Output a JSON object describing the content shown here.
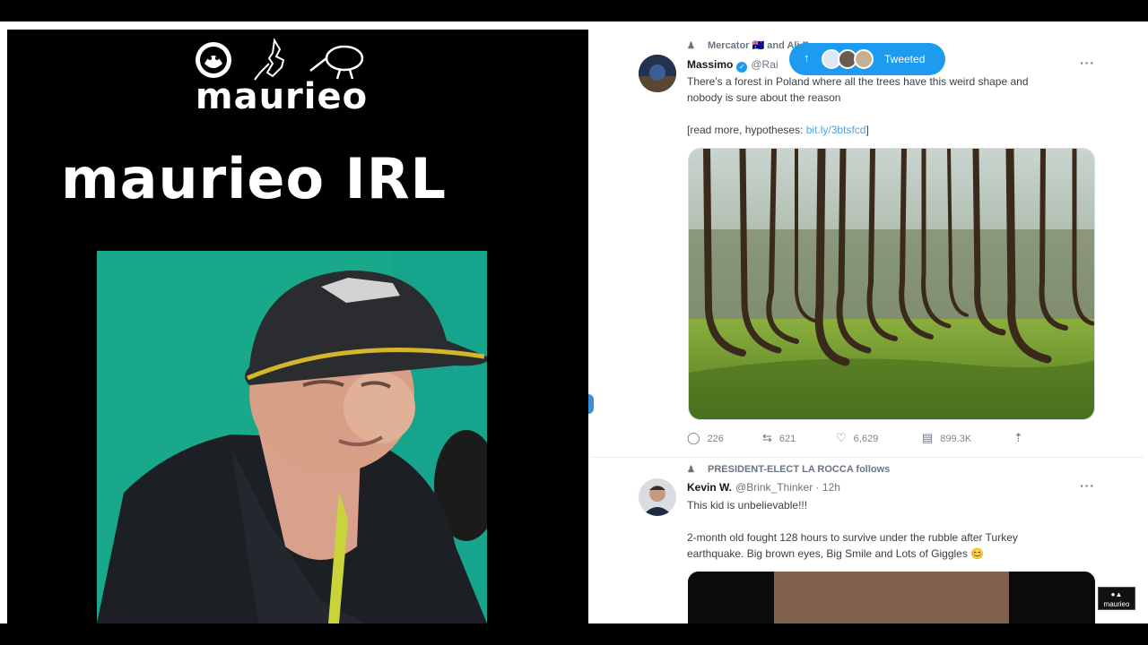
{
  "left": {
    "logo_text": "maurieo",
    "title": "maurieo IRL"
  },
  "feed": {
    "tweeted_pill_label": "Tweeted",
    "tweet1": {
      "social_context": "Mercator 🇦🇺 and Ali B",
      "author_name": "Massimo",
      "handle": "@Rai",
      "text_line1": "There's a forest in Poland where all the trees have this weird shape and",
      "text_line2": "nobody is sure about the reason",
      "read_more_prefix": "[read more, hypotheses:",
      "read_more_link": "bit.ly/3btsfcd",
      "read_more_suffix": "]",
      "replies": "226",
      "retweets": "621",
      "likes": "6,629",
      "views": "899.3K"
    },
    "tweet2": {
      "social_context": "PRESIDENT-ELECT LA ROCCA follows",
      "author_name": "Kevin W.",
      "handle": "@Brink_Thinker · 12h",
      "text_line1": "This kid is unbelievable!!!",
      "text_line2": "2-month old fought 128 hours to survive under the rubble after Turkey",
      "text_line3": "earthquake. Big brown eyes, Big Smile   and Lots of Giggles 😊"
    }
  },
  "watermark": {
    "line1": "maurieo"
  },
  "colors": {
    "accent": "#1d9bf0",
    "greenscreen": "#1aa88a",
    "panel_bg": "#000000"
  },
  "icons": [
    "person-icon",
    "verified-badge-icon",
    "more-icon",
    "reply-icon",
    "retweet-icon",
    "like-icon",
    "views-icon",
    "share-icon",
    "arrow-up-icon"
  ]
}
